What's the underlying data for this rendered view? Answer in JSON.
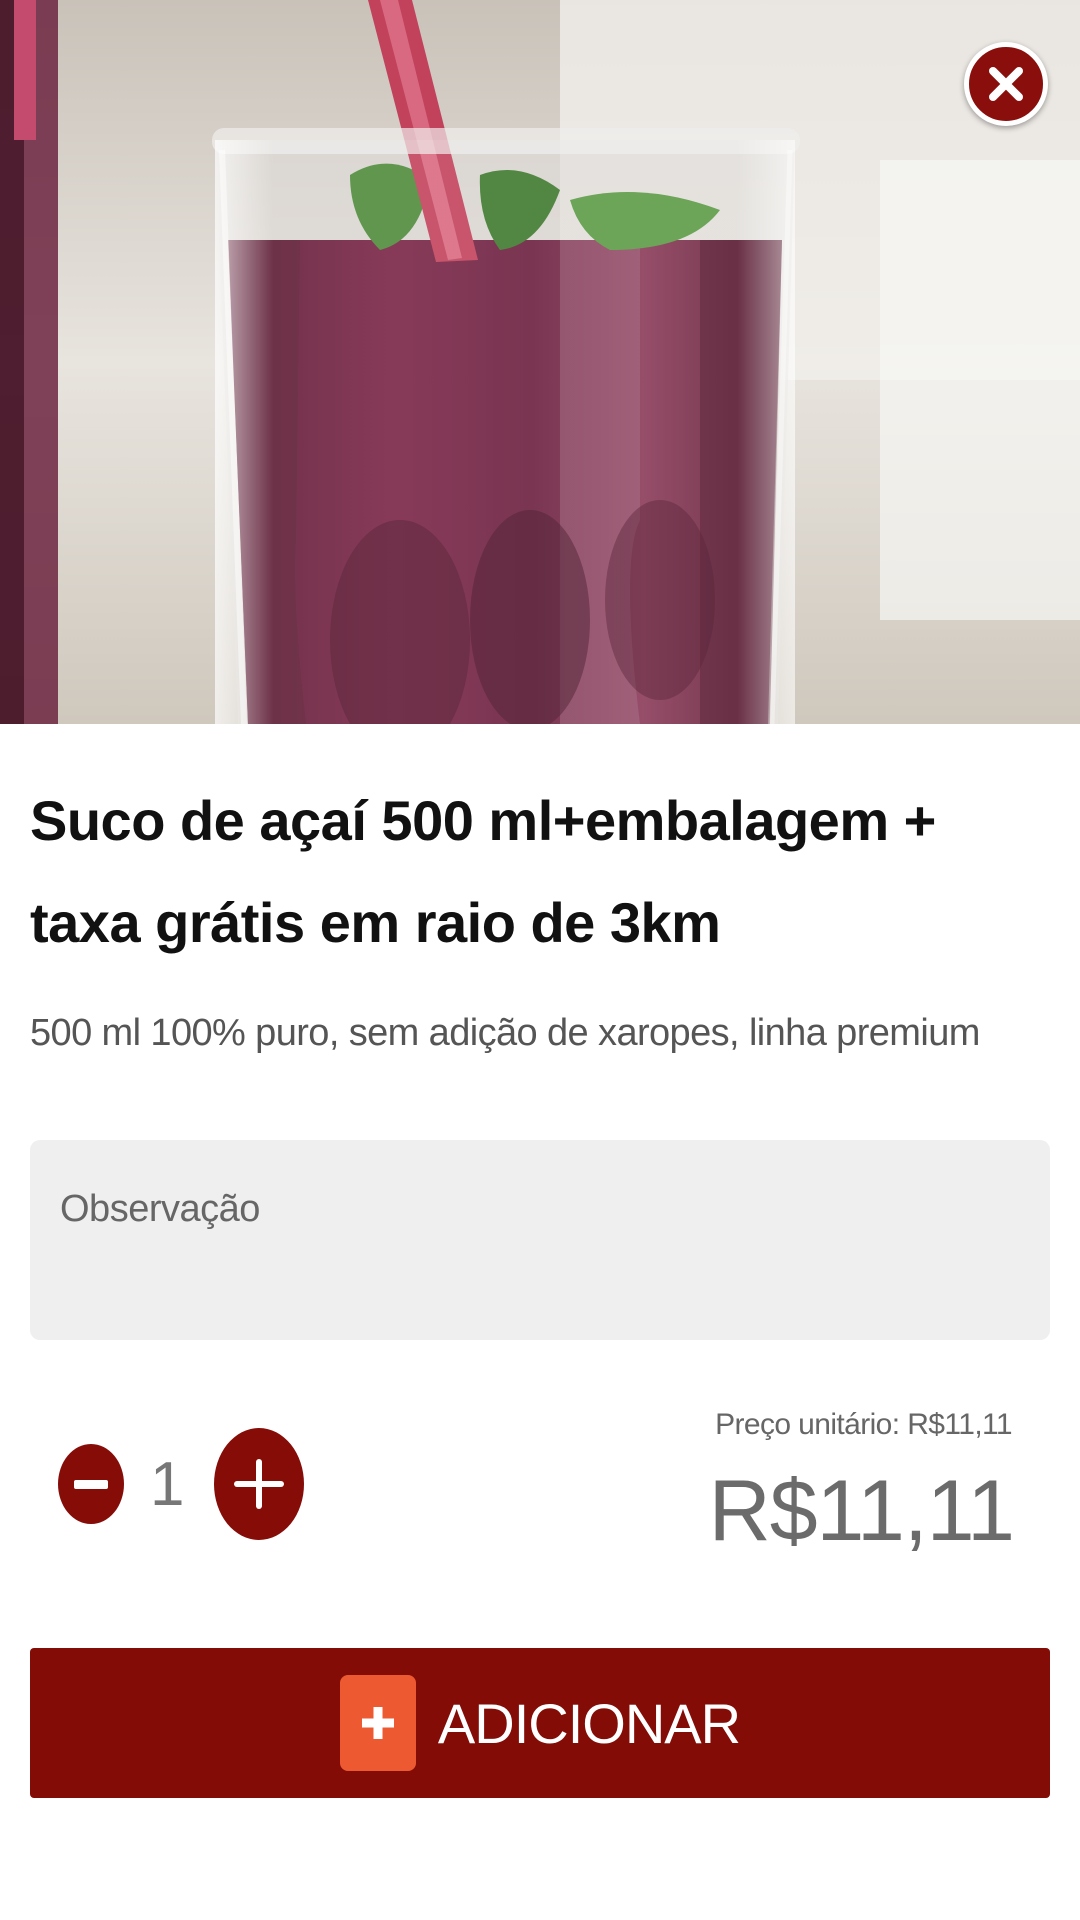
{
  "product": {
    "image_alt": "Suco de açaí",
    "title": "Suco de açaí 500 ml+embalagem + taxa grátis em raio de 3km",
    "description": "500 ml 100% puro, sem adição de xaropes, linha premium"
  },
  "observation": {
    "placeholder": "Observação",
    "value": ""
  },
  "quantity": {
    "value": "1"
  },
  "price": {
    "unit": "Preço unitário: R$11,11",
    "total": "R$11,11"
  },
  "actions": {
    "add_label": "ADICIONAR",
    "close_icon": "close-icon"
  },
  "colors": {
    "brand_dark_red": "#840c06",
    "accent_orange": "#ed5a32",
    "input_bg": "#efefef"
  }
}
